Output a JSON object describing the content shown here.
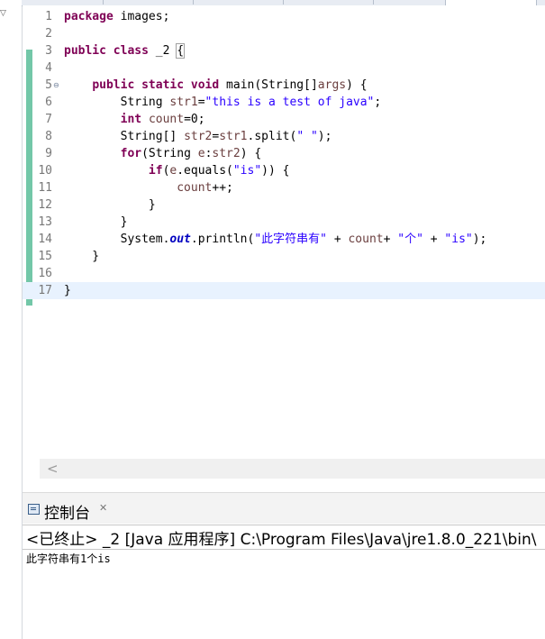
{
  "editor": {
    "lines": [
      {
        "n": "1",
        "tokens": [
          {
            "t": "package",
            "c": "kw"
          },
          {
            "t": " images;"
          }
        ]
      },
      {
        "n": "2",
        "tokens": []
      },
      {
        "n": "3",
        "tokens": [
          {
            "t": "public",
            "c": "kw"
          },
          {
            "t": " "
          },
          {
            "t": "class",
            "c": "kw"
          },
          {
            "t": " _2 "
          },
          {
            "t": "{",
            "c": "cur"
          }
        ]
      },
      {
        "n": "4",
        "tokens": []
      },
      {
        "n": "5",
        "fold": "⊖",
        "tokens": [
          {
            "t": "    "
          },
          {
            "t": "public",
            "c": "kw"
          },
          {
            "t": " "
          },
          {
            "t": "static",
            "c": "kw"
          },
          {
            "t": " "
          },
          {
            "t": "void",
            "c": "kw"
          },
          {
            "t": " main(String[]"
          },
          {
            "t": "args",
            "c": "var"
          },
          {
            "t": ") {"
          }
        ]
      },
      {
        "n": "6",
        "tokens": [
          {
            "t": "        String "
          },
          {
            "t": "str1",
            "c": "var"
          },
          {
            "t": "="
          },
          {
            "t": "\"this is a test of java\"",
            "c": "str"
          },
          {
            "t": ";"
          }
        ]
      },
      {
        "n": "7",
        "tokens": [
          {
            "t": "        "
          },
          {
            "t": "int",
            "c": "kw"
          },
          {
            "t": " "
          },
          {
            "t": "count",
            "c": "var"
          },
          {
            "t": "=0;"
          }
        ]
      },
      {
        "n": "8",
        "tokens": [
          {
            "t": "        String[] "
          },
          {
            "t": "str2",
            "c": "var"
          },
          {
            "t": "="
          },
          {
            "t": "str1",
            "c": "var"
          },
          {
            "t": ".split("
          },
          {
            "t": "\" \"",
            "c": "str"
          },
          {
            "t": ");"
          }
        ]
      },
      {
        "n": "9",
        "tokens": [
          {
            "t": "        "
          },
          {
            "t": "for",
            "c": "kw"
          },
          {
            "t": "(String "
          },
          {
            "t": "e",
            "c": "var"
          },
          {
            "t": ":"
          },
          {
            "t": "str2",
            "c": "var"
          },
          {
            "t": ") {"
          }
        ]
      },
      {
        "n": "10",
        "tokens": [
          {
            "t": "            "
          },
          {
            "t": "if",
            "c": "kw"
          },
          {
            "t": "("
          },
          {
            "t": "e",
            "c": "var"
          },
          {
            "t": ".equals("
          },
          {
            "t": "\"is\"",
            "c": "str"
          },
          {
            "t": ")) {"
          }
        ]
      },
      {
        "n": "11",
        "tokens": [
          {
            "t": "                "
          },
          {
            "t": "count",
            "c": "var"
          },
          {
            "t": "++;"
          }
        ]
      },
      {
        "n": "12",
        "tokens": [
          {
            "t": "            }"
          }
        ]
      },
      {
        "n": "13",
        "tokens": [
          {
            "t": "        }"
          }
        ]
      },
      {
        "n": "14",
        "tokens": [
          {
            "t": "        System."
          },
          {
            "t": "out",
            "c": "sf"
          },
          {
            "t": ".println("
          },
          {
            "t": "\"此字符串有\"",
            "c": "str"
          },
          {
            "t": " + "
          },
          {
            "t": "count",
            "c": "var"
          },
          {
            "t": "+ "
          },
          {
            "t": "\"个\"",
            "c": "str"
          },
          {
            "t": " + "
          },
          {
            "t": "\"is\"",
            "c": "str"
          },
          {
            "t": ");"
          }
        ]
      },
      {
        "n": "15",
        "tokens": [
          {
            "t": "    }"
          }
        ]
      },
      {
        "n": "16",
        "tokens": []
      },
      {
        "n": "17",
        "highlight": true,
        "tokens": [
          {
            "t": "}"
          }
        ]
      }
    ],
    "colors": {
      "keyword": "#7f0055",
      "string": "#2a00ff",
      "variable": "#6a3e3e",
      "static_field": "#0000c0",
      "line_number": "#787878",
      "current_line": "#e8f2fe",
      "change_bar": "#73c7a8"
    }
  },
  "hscroll": {
    "left_arrow": "<"
  },
  "console": {
    "tab_label": "控制台",
    "tab_close": "✕",
    "icon": "console-icon",
    "header": "<已终止> _2 [Java 应用程序] C:\\Program Files\\Java\\jre1.8.0_221\\bin\\",
    "output": "此字符串有1个is"
  }
}
